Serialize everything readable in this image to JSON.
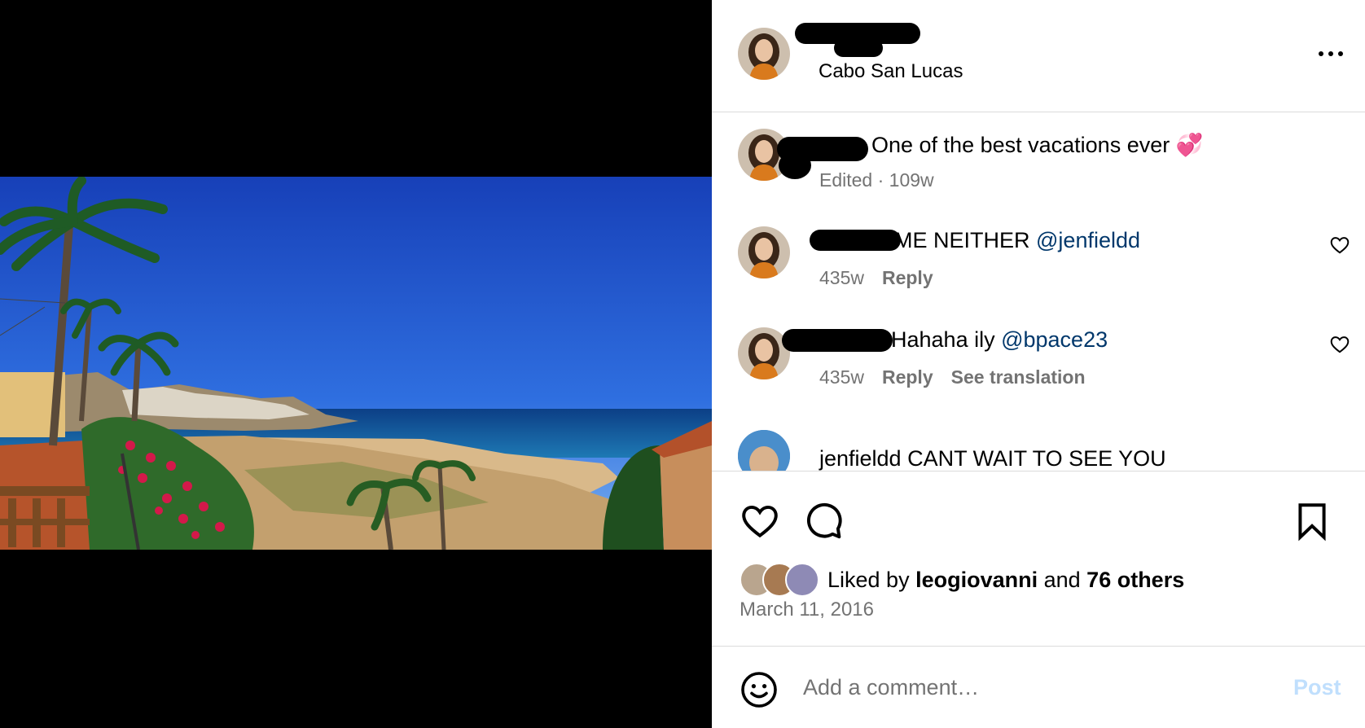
{
  "post": {
    "location": "Cabo San Lucas",
    "more_icon": "more-horizontal-icon"
  },
  "comments": [
    {
      "text": "One of the best vacations ever",
      "emoji": "💞",
      "meta": "Edited · 109w"
    },
    {
      "text": "ME NEITHER ",
      "mention": "@jenfieldd",
      "time": "435w",
      "reply": "Reply",
      "heart_icon": "heart-outline-icon"
    },
    {
      "text": "Hahaha ily ",
      "mention": "@bpace23",
      "time": "435w",
      "reply": "Reply",
      "translation": "See translation",
      "heart_icon": "heart-outline-icon"
    },
    {
      "text": "jenfieldd CANT WAIT TO SEE YOU"
    }
  ],
  "actions": {
    "like_icon": "heart-outline-icon",
    "comment_icon": "comment-bubble-icon",
    "save_icon": "bookmark-icon"
  },
  "likes": {
    "prefix": "Liked by ",
    "user": "leogiovanni",
    "mid": " and ",
    "others": "76 others"
  },
  "date": "March 11, 2016",
  "composer": {
    "placeholder": "Add a comment…",
    "post_label": "Post",
    "emoji_icon": "smiley-icon"
  },
  "colors": {
    "link": "#00376b",
    "secondary": "#737373",
    "divider": "#dbdbdb",
    "post_disabled": "#c0dffd"
  }
}
